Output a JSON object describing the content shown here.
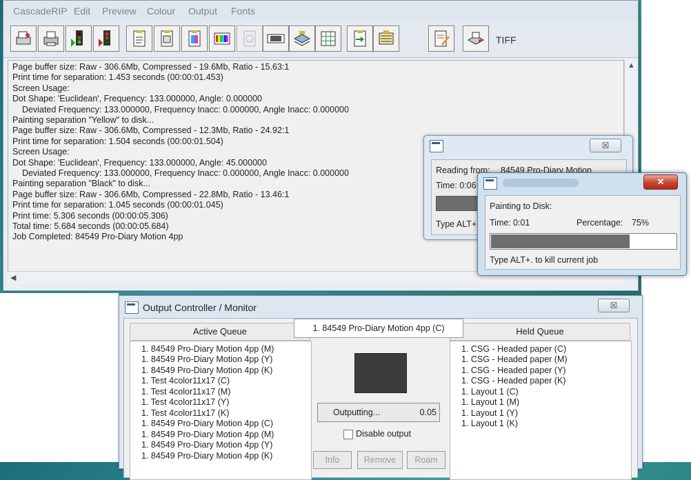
{
  "menu": [
    "CascadeRIP",
    "Edit",
    "Preview",
    "Colour",
    "Output",
    "Fonts"
  ],
  "toolbar": {
    "icons": [
      "rip-file-icon",
      "print-icon",
      "traffic-light-green-icon",
      "traffic-light-red-icon",
      "page-setup-icon",
      "page-icon",
      "colour-page-icon",
      "colour-bars-icon",
      "disabled-page-icon",
      "film-icon",
      "layers-icon",
      "grid-icon",
      "page-arrow-icon",
      "page-stack-icon"
    ],
    "output_device": "TIFF"
  },
  "log": [
    "Page buffer size: Raw - 306.6Mb, Compressed - 19.6Mb, Ratio - 15.63:1",
    "Print time for separation: 1.453 seconds (00:00:01.453)",
    "Screen Usage:",
    "  Dot Shape: 'Euclidean', Frequency: 133.000000, Angle: 0.000000",
    "     Deviated Frequency: 133.000000, Frequency Inacc: 0.000000, Angle Inacc: 0.000000",
    "Painting separation \"Yellow\" to disk...",
    "Page buffer size: Raw - 306.6Mb, Compressed - 12.3Mb, Ratio - 24.92:1",
    "Print time for separation: 1.504 seconds (00:00:01.504)",
    "Screen Usage:",
    "  Dot Shape: 'Euclidean', Frequency: 133.000000, Angle: 45.000000",
    "     Deviated Frequency: 133.000000, Frequency Inacc: 0.000000, Angle Inacc: 0.000000",
    "Painting separation \"Black\" to disk...",
    "Page buffer size: Raw - 306.6Mb, Compressed - 22.8Mb, Ratio - 13.46:1",
    "Print time for separation: 1.045 seconds (00:00:01.045)",
    "Print time: 5.306 seconds (00:00:05.306)",
    "Total time: 5.684 seconds (00:00:05.684)",
    "Job Completed: 84549 Pro-Diary Motion 4pp"
  ],
  "reading_dialog": {
    "reading_label": "Reading from:",
    "reading_value": "84549 Pro-Diary Motion",
    "time_label": "Time: 0:06",
    "kill_text": "Type ALT+. to kill current job"
  },
  "painting_dialog": {
    "heading": "Painting to Disk:",
    "time_label": "Time:",
    "time_value": "0:01",
    "percentage_label": "Percentage:",
    "percentage_value": "75%",
    "progress_fraction": 0.75,
    "kill_text": "Type ALT+. to kill current job"
  },
  "output_controller": {
    "title": "Output Controller / Monitor",
    "active_queue_title": "Active Queue",
    "held_queue_title": "Held Queue",
    "current_job": "1. 84549 Pro-Diary Motion 4pp (C)",
    "active_queue": [
      "1. 84549 Pro-Diary Motion 4pp (M)",
      "1. 84549 Pro-Diary Motion 4pp (Y)",
      "1. 84549 Pro-Diary Motion 4pp (K)",
      "1. Test 4color11x17 (C)",
      "1. Test 4color11x17 (M)",
      "1. Test 4color11x17 (Y)",
      "1. Test 4color11x17 (K)",
      "1. 84549 Pro-Diary Motion 4pp (C)",
      "1. 84549 Pro-Diary Motion 4pp (M)",
      "1. 84549 Pro-Diary Motion 4pp (Y)",
      "1. 84549 Pro-Diary Motion 4pp (K)"
    ],
    "held_queue": [
      "1. CSG - Headed paper (C)",
      "1. CSG - Headed paper (M)",
      "1. CSG - Headed paper (Y)",
      "1. CSG - Headed paper (K)",
      "1. Layout 1 (C)",
      "1. Layout 1 (M)",
      "1. Layout 1 (Y)",
      "1. Layout 1 (K)"
    ],
    "status_label": "Outputting...",
    "status_value": "0.05",
    "disable_output_label": "Disable output",
    "buttons": [
      "Info",
      "Remove",
      "Roam"
    ]
  }
}
